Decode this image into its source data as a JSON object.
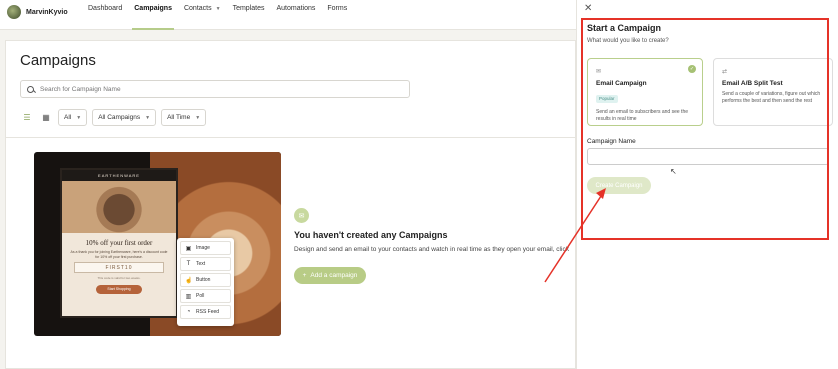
{
  "brand": {
    "name": "MarvinKyvio"
  },
  "nav": {
    "items": [
      {
        "label": "Dashboard"
      },
      {
        "label": "Campaigns"
      },
      {
        "label": "Contacts"
      },
      {
        "label": "Templates"
      },
      {
        "label": "Automations"
      },
      {
        "label": "Forms"
      }
    ]
  },
  "page": {
    "title": "Campaigns",
    "search_placeholder": "Search for Campaign Name",
    "filters": {
      "status": "All",
      "type": "All Campaigns",
      "time": "All Time"
    }
  },
  "preview": {
    "brand_header": "EARTHENWARE",
    "headline": "10% off your first order",
    "body": "As a thank you for joining Earthenware, here's a discount code for 10% off your first purchase.",
    "code": "FIRST10",
    "note": "This code is valid for two weeks.",
    "cta": "Start Shopping",
    "blocks": [
      "Image",
      "Text",
      "Button",
      "Poll",
      "RSS Feed"
    ]
  },
  "empty_state": {
    "title": "You haven't created any Campaigns",
    "description": "Design and send an email to your contacts and watch in real time as they open your email, click",
    "button": "Add a campaign"
  },
  "panel": {
    "title": "Start a Campaign",
    "subtitle": "What would you like to create?",
    "options": [
      {
        "title": "Email Campaign",
        "badge": "Popular",
        "description": "Send an email to subscribers and see the results in real time"
      },
      {
        "title": "Email A/B Split Test",
        "description": "Send a couple of variations, figure out which performs the best and then send the rest"
      }
    ],
    "name_label": "Campaign Name",
    "name_value": "",
    "create_button": "Create Campaign"
  },
  "colors": {
    "accent": "#b8cc86",
    "highlight": "#e53228"
  }
}
